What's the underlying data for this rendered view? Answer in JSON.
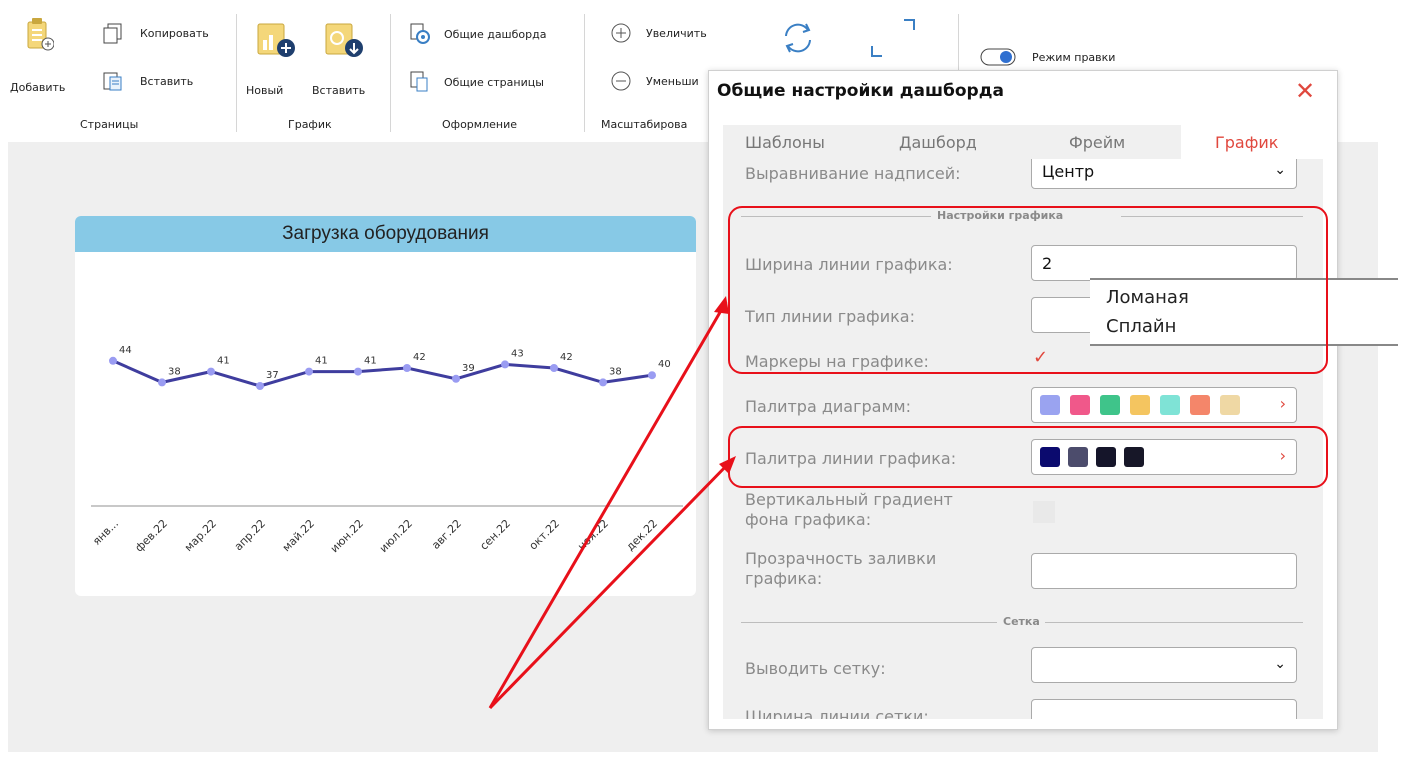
{
  "ribbon": {
    "add": "Добавить",
    "copy": "Копировать",
    "paste_page": "Вставить",
    "pages_group": "Страницы",
    "new_chart": "Новый",
    "paste_chart": "Вставить",
    "chart_group": "График",
    "common_dashboards": "Общие дашборда",
    "common_pages": "Общие страницы",
    "design_group": "Оформление",
    "zoom_in": "Увеличить",
    "zoom_out": "Уменьши",
    "zoom_group": "Масштабирова",
    "edit_mode": "Режим правки"
  },
  "chart_data": {
    "type": "line",
    "title": "Загрузка оборудования",
    "categories": [
      "янв...",
      "фев.22",
      "мар.22",
      "апр.22",
      "май.22",
      "июн.22",
      "июл.22",
      "авг.22",
      "сен.22",
      "окт.22",
      "ноя.22",
      "дек.22"
    ],
    "values": [
      44,
      38,
      41,
      37,
      41,
      41,
      42,
      39,
      43,
      42,
      38,
      40
    ],
    "line_color": "#3f3d9e",
    "marker_color": "#9a9cf2"
  },
  "dialog": {
    "title": "Общие настройки дашборда",
    "close": "✕",
    "tabs": [
      "Шаблоны",
      "Дашборд",
      "Фрейм",
      "График"
    ],
    "active_tab": "График",
    "align_label": "Выравнивание надписей:",
    "align_value": "Центр",
    "chart_settings_section": "Настройки графика",
    "line_width_label": "Ширина линии графика:",
    "line_width_value": "2",
    "line_type_label": "Тип линии графика:",
    "markers_label": "Маркеры на графике:",
    "markers_check": "✓",
    "diagram_palette_label": "Палитра диаграмм:",
    "diagram_palette": [
      "#9aa3f0",
      "#f0588a",
      "#3fc48a",
      "#f4c560",
      "#7fe3d6",
      "#f4866a",
      "#efd8a4"
    ],
    "line_palette_label": "Палитра линии графика:",
    "line_palette": [
      "#0b0a6e",
      "#4c4c6c",
      "#15152a",
      "#171728"
    ],
    "gradient_label_1": "Вертикальный градиент",
    "gradient_label_2": "фона графика:",
    "opacity_label_1": "Прозрачность заливки",
    "opacity_label_2": "графика:",
    "grid_section": "Сетка",
    "show_grid_label": "Выводить сетку:",
    "grid_width_label": "Ширина линии сетки:",
    "arrow_glyph": "›",
    "chevron_glyph": "⌄"
  },
  "popup": {
    "options": [
      "Ломаная",
      "Сплайн"
    ]
  },
  "colors": {
    "accent_red": "#e0483e",
    "highlight_red": "#e8101a",
    "title_bar": "#87c9e6"
  }
}
